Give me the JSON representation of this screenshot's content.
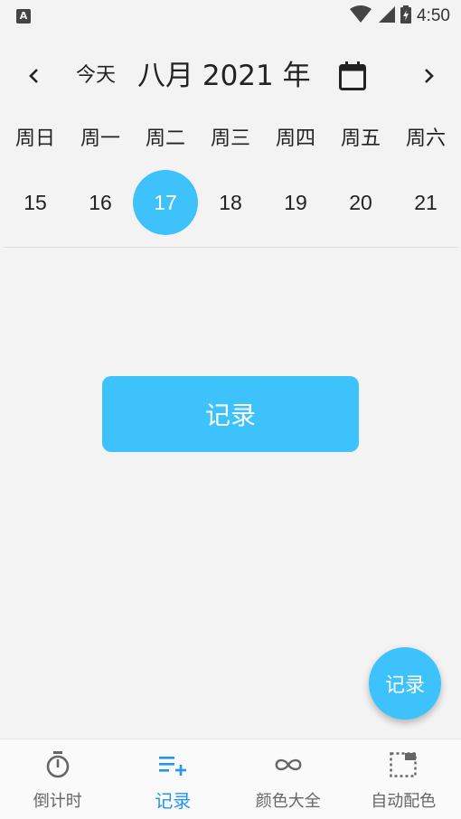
{
  "status_bar": {
    "time": "4:50",
    "notification_icon": "A"
  },
  "header": {
    "today_label": "今天",
    "month_title": "八月 2021 年"
  },
  "week": {
    "days": [
      "周日",
      "周一",
      "周二",
      "周三",
      "周四",
      "周五",
      "周六"
    ],
    "dates": [
      "15",
      "16",
      "17",
      "18",
      "19",
      "20",
      "21"
    ],
    "selected_date": "17"
  },
  "main": {
    "record_label": "记录"
  },
  "fab": {
    "label": "记录"
  },
  "bottom_nav": {
    "items": [
      {
        "label": "倒计时",
        "icon": "timer-icon"
      },
      {
        "label": "记录",
        "icon": "playlist-add-icon"
      },
      {
        "label": "颜色大全",
        "icon": "infinity-icon"
      },
      {
        "label": "自动配色",
        "icon": "selection-icon"
      }
    ],
    "active_index": 1
  },
  "colors": {
    "accent": "#3ec2fb",
    "active_nav": "#2196f3",
    "background": "#f3f3f3"
  }
}
